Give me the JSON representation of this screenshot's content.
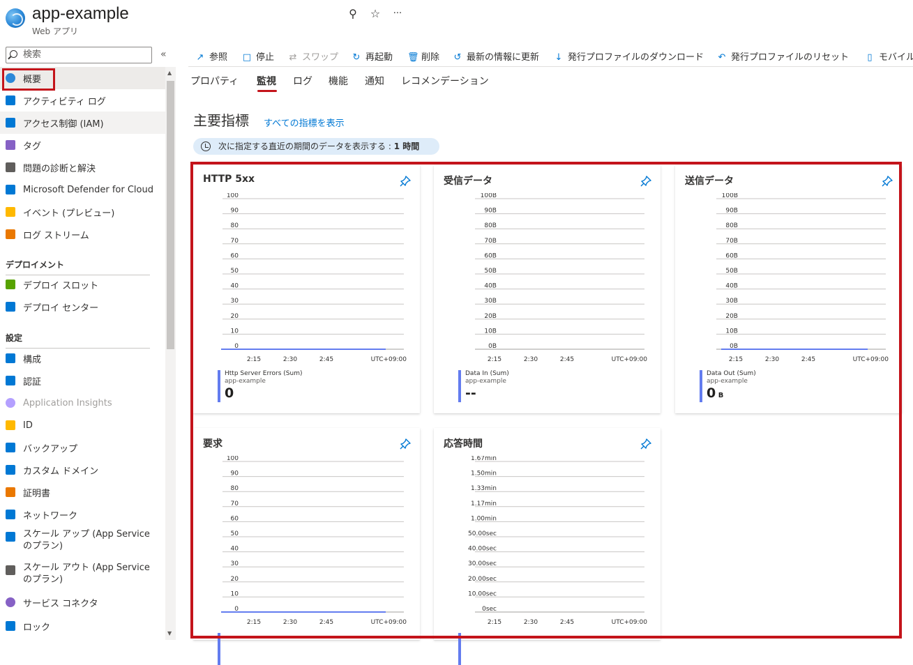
{
  "header": {
    "title": "app-example",
    "subtitle": "Web アプリ",
    "pin_glyph": "⚲",
    "star_glyph": "☆",
    "more_glyph": "···"
  },
  "sidebar": {
    "search_placeholder": "検索",
    "collapse_glyph": "«",
    "items": [
      {
        "label": "概要",
        "icon": "overview-icon",
        "color": "#2b88d8"
      },
      {
        "label": "アクティビティ ログ",
        "icon": "activity-log-icon",
        "color": "#0078d4"
      },
      {
        "label": "アクセス制御 (IAM)",
        "icon": "iam-icon",
        "color": "#0078d4"
      },
      {
        "label": "タグ",
        "icon": "tag-icon",
        "color": "#8661c5"
      },
      {
        "label": "問題の診断と解決",
        "icon": "wrench-icon",
        "color": "#605e5c"
      },
      {
        "label": "Microsoft Defender for Cloud",
        "icon": "shield-icon",
        "color": "#0078d4"
      },
      {
        "label": "イベント (プレビュー)",
        "icon": "lightning-icon",
        "color": "#ffb900"
      },
      {
        "label": "ログ ストリーム",
        "icon": "log-stream-icon",
        "color": "#ea7800"
      },
      {
        "label": "デプロイ スロット",
        "icon": "deploy-slot-icon",
        "color": "#57a300"
      },
      {
        "label": "デプロイ センター",
        "icon": "deploy-center-icon",
        "color": "#0078d4"
      },
      {
        "label": "構成",
        "icon": "config-icon",
        "color": "#0078d4"
      },
      {
        "label": "認証",
        "icon": "auth-icon",
        "color": "#0078d4"
      },
      {
        "label": "Application Insights",
        "icon": "app-insights-icon",
        "color": "#b4a0ff"
      },
      {
        "label": "ID",
        "icon": "identity-icon",
        "color": "#ffb900"
      },
      {
        "label": "バックアップ",
        "icon": "backup-icon",
        "color": "#0078d4"
      },
      {
        "label": "カスタム ドメイン",
        "icon": "domain-icon",
        "color": "#0078d4"
      },
      {
        "label": "証明書",
        "icon": "certificate-icon",
        "color": "#ea7800"
      },
      {
        "label": "ネットワーク",
        "icon": "network-icon",
        "color": "#0078d4"
      },
      {
        "label": "スケール アップ (App Service のプラン)",
        "icon": "scale-up-icon",
        "color": "#0078d4"
      },
      {
        "label": "スケール アウト (App Service のプラン)",
        "icon": "scale-out-icon",
        "color": "#605e5c"
      },
      {
        "label": "サービス コネクタ",
        "icon": "service-connector-icon",
        "color": "#8661c5"
      },
      {
        "label": "ロック",
        "icon": "lock-icon",
        "color": "#0078d4"
      }
    ],
    "sections": [
      "デプロイメント",
      "設定"
    ]
  },
  "toolbar": [
    {
      "label": "参照",
      "glyph": "↗",
      "disabled": false
    },
    {
      "label": "停止",
      "glyph": "□",
      "disabled": false
    },
    {
      "label": "スワップ",
      "glyph": "⇄",
      "disabled": true
    },
    {
      "label": "再起動",
      "glyph": "↻",
      "disabled": false
    },
    {
      "label": "削除",
      "glyph": "🗑",
      "disabled": false
    },
    {
      "label": "最新の情報に更新",
      "glyph": "↺",
      "disabled": false
    },
    {
      "label": "発行プロファイルのダウンロード",
      "glyph": "↓",
      "disabled": false
    },
    {
      "label": "発行プロファイルのリセット",
      "glyph": "↶",
      "disabled": false
    },
    {
      "label": "モバイル",
      "glyph": "▯",
      "disabled": false
    }
  ],
  "tabs": [
    "プロパティ",
    "監視",
    "ログ",
    "機能",
    "通知",
    "レコメンデーション"
  ],
  "main": {
    "section_title": "主要指標",
    "see_all_link": "すべての指標を表示",
    "time_prefix": "次に指定する直近の期間のデータを表示する : ",
    "time_value": "1 時間"
  },
  "chart_data": [
    {
      "type": "line",
      "title": "HTTP 5xx",
      "y_ticks": [
        "100",
        "90",
        "80",
        "70",
        "60",
        "50",
        "40",
        "30",
        "20",
        "10",
        "0"
      ],
      "x_ticks": [
        "2:15",
        "2:30",
        "2:45"
      ],
      "timezone": "UTC+09:00",
      "series": [
        {
          "name": "Http Server Errors (Sum)",
          "resource": "app-example",
          "values": [
            0,
            0,
            0,
            0,
            0,
            0,
            0,
            0,
            0,
            0,
            0,
            0
          ]
        }
      ],
      "summary": "0",
      "summary_unit": "",
      "series_color": "#637cef"
    },
    {
      "type": "line",
      "title": "受信データ",
      "y_ticks": [
        "100B",
        "90B",
        "80B",
        "70B",
        "60B",
        "50B",
        "40B",
        "30B",
        "20B",
        "10B",
        "0B"
      ],
      "x_ticks": [
        "2:15",
        "2:30",
        "2:45"
      ],
      "timezone": "UTC+09:00",
      "series": [
        {
          "name": "Data In (Sum)",
          "resource": "app-example",
          "values": []
        }
      ],
      "summary": "--",
      "summary_unit": "",
      "series_color": "#637cef"
    },
    {
      "type": "line",
      "title": "送信データ",
      "y_ticks": [
        "100B",
        "90B",
        "80B",
        "70B",
        "60B",
        "50B",
        "40B",
        "30B",
        "20B",
        "10B",
        "0B"
      ],
      "x_ticks": [
        "2:15",
        "2:30",
        "2:45"
      ],
      "timezone": "UTC+09:00",
      "series": [
        {
          "name": "Data Out (Sum)",
          "resource": "app-example",
          "values": [
            0,
            0,
            0,
            0,
            0,
            0,
            0,
            0,
            0,
            0,
            0,
            0
          ]
        }
      ],
      "summary": "0",
      "summary_unit": "B",
      "series_color": "#637cef"
    },
    {
      "type": "line",
      "title": "要求",
      "y_ticks": [
        "100",
        "90",
        "80",
        "70",
        "60",
        "50",
        "40",
        "30",
        "20",
        "10",
        "0"
      ],
      "x_ticks": [
        "2:15",
        "2:30",
        "2:45"
      ],
      "timezone": "UTC+09:00",
      "series": [
        {
          "name": "",
          "resource": "",
          "values": [
            0,
            0,
            0,
            0,
            0,
            0,
            0,
            0,
            0,
            0,
            0,
            0
          ]
        }
      ],
      "summary": "",
      "summary_unit": "",
      "series_color": "#637cef"
    },
    {
      "type": "line",
      "title": "応答時間",
      "y_ticks": [
        "1.67min",
        "1.50min",
        "1.33min",
        "1.17min",
        "1.00min",
        "50.00sec",
        "40.00sec",
        "30.00sec",
        "20.00sec",
        "10.00sec",
        "0sec"
      ],
      "x_ticks": [
        "2:15",
        "2:30",
        "2:45"
      ],
      "timezone": "UTC+09:00",
      "series": [
        {
          "name": "",
          "resource": "",
          "values": []
        }
      ],
      "summary": "",
      "summary_unit": "",
      "series_color": "#637cef"
    }
  ]
}
